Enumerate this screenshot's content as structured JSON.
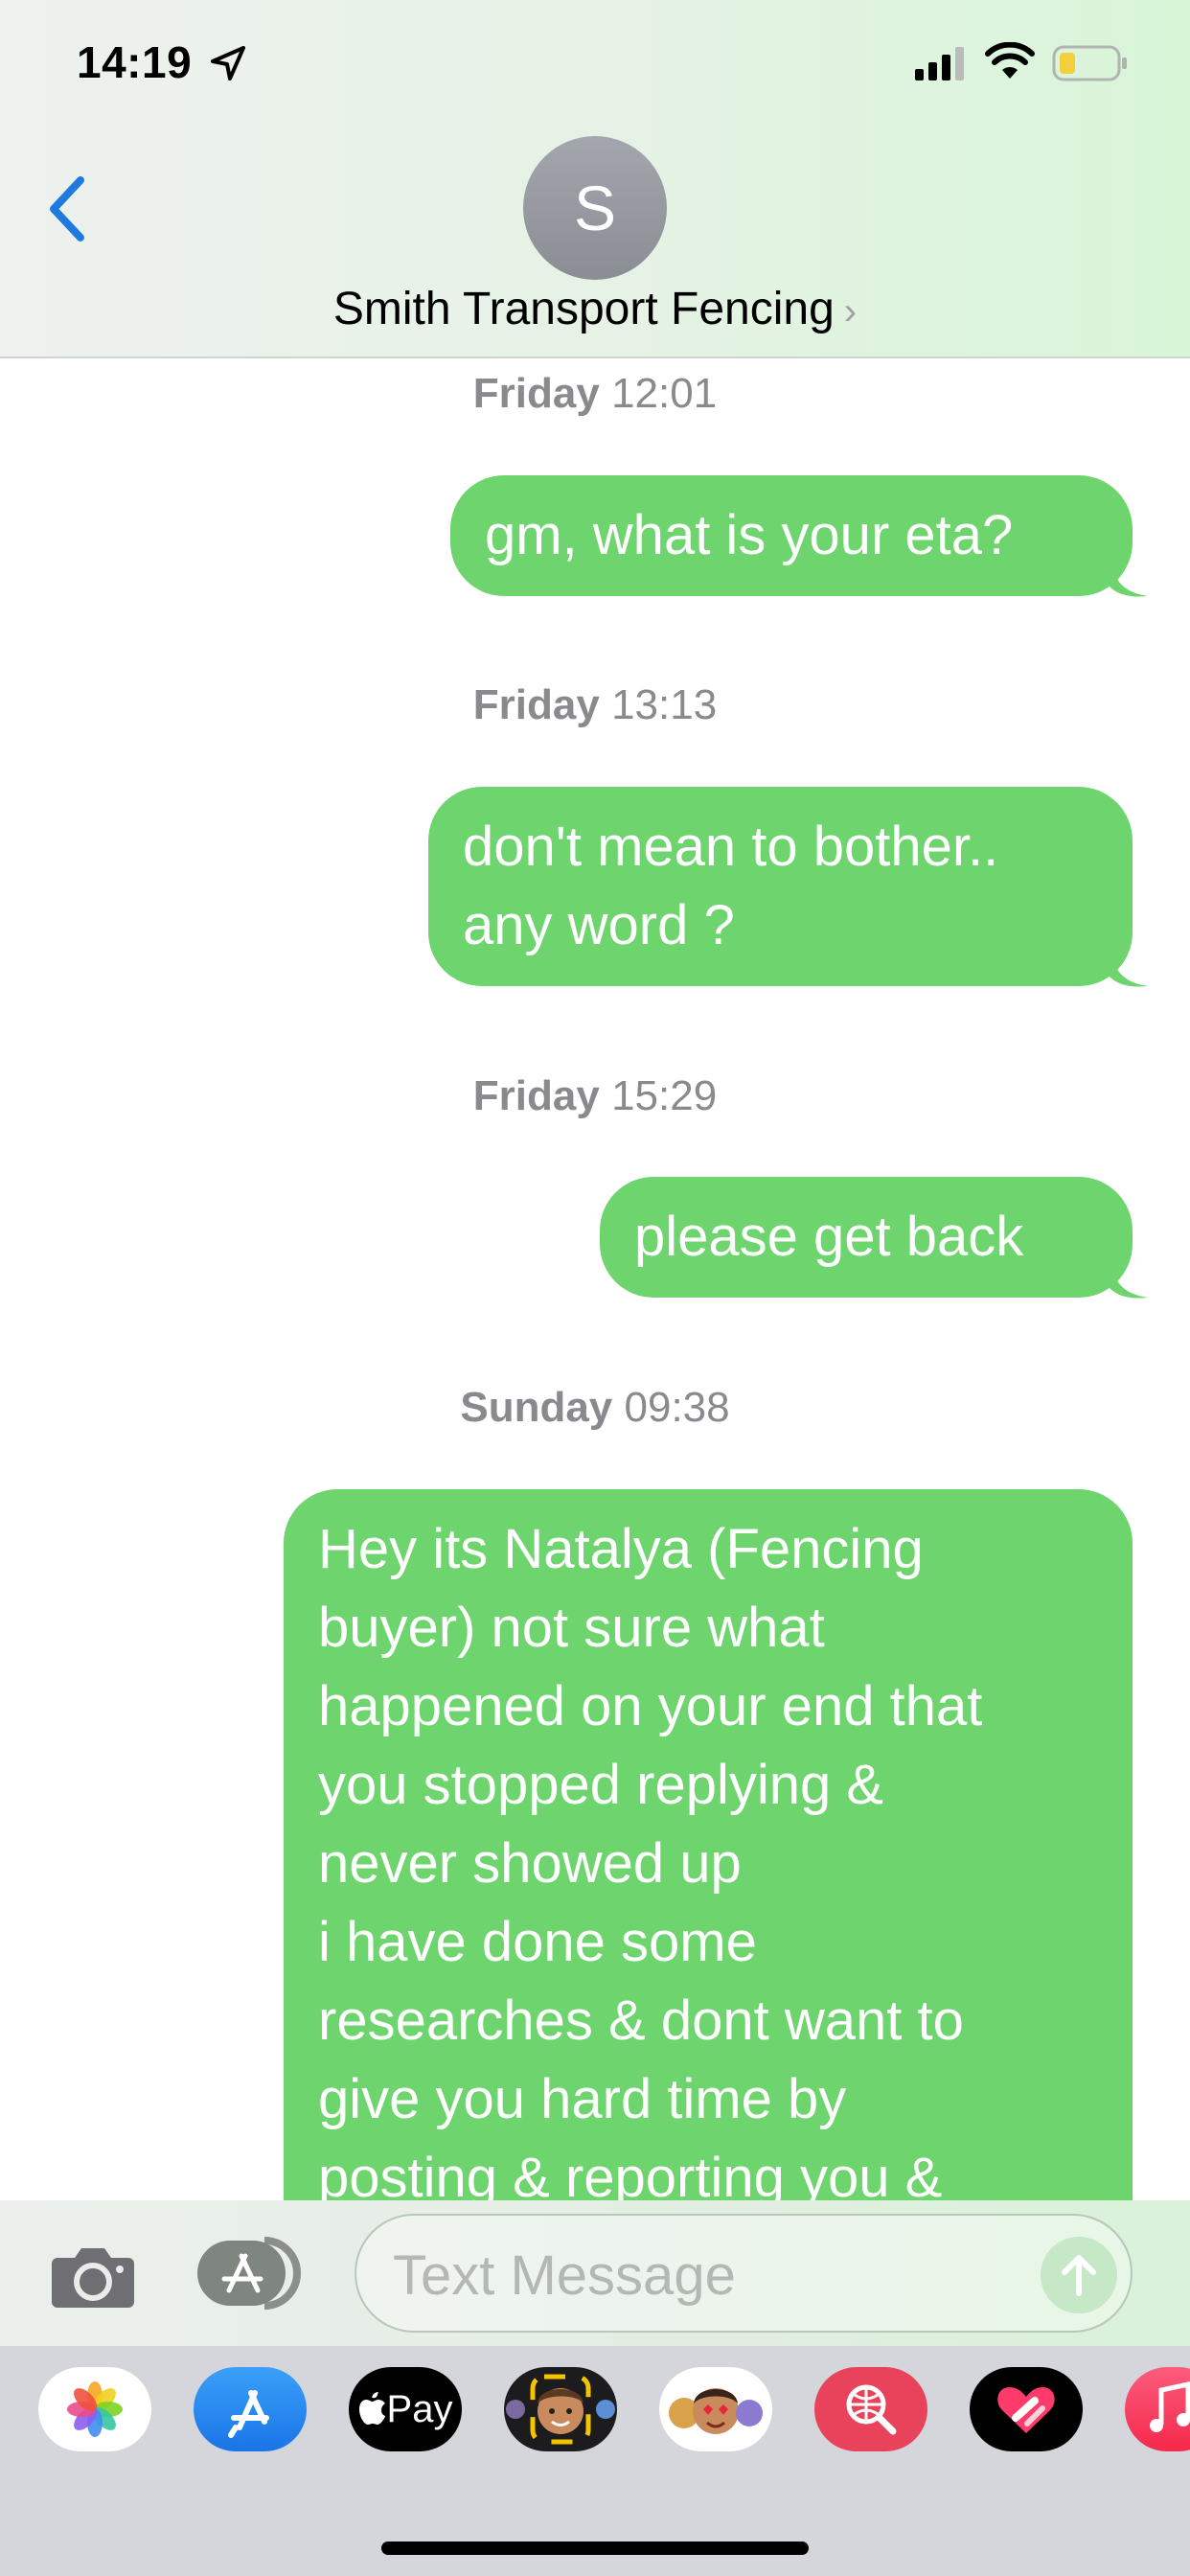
{
  "status_bar": {
    "time": "14:19"
  },
  "header": {
    "avatar_initial": "S",
    "contact_name": "Smith Transport Fencing",
    "chevron": "›"
  },
  "thread": [
    {
      "day": "Friday",
      "time": "12:01",
      "message": "gm, what is your eta?"
    },
    {
      "day": "Friday",
      "time": "13:13",
      "message_lines": [
        "don't mean to bother..",
        "any word ?"
      ]
    },
    {
      "day": "Friday",
      "time": "15:29",
      "message": "please get back"
    },
    {
      "day": "Sunday",
      "time": "09:38",
      "message_lines": [
        "Hey its Natalya (Fencing",
        "buyer) not sure what",
        "happened on your end that",
        "you stopped replying &",
        "never showed up",
        "i have done some",
        "researches & dont want to",
        "give you hard time  by",
        "posting & reporting you &"
      ]
    }
  ],
  "input_bar": {
    "placeholder": "Text Message"
  },
  "app_drawer": {
    "apple_pay_label": "Pay",
    "icons": [
      "photos-icon",
      "app-store-icon",
      "apple-pay-icon",
      "memoji-icon",
      "animoji-stickers-icon",
      "search-images-icon",
      "digital-touch-icon",
      "music-icon"
    ]
  },
  "colors": {
    "sent_bubble": "#6ed46e",
    "timestamp": "#8a8a8e",
    "back_chevron": "#1f7ae0"
  }
}
